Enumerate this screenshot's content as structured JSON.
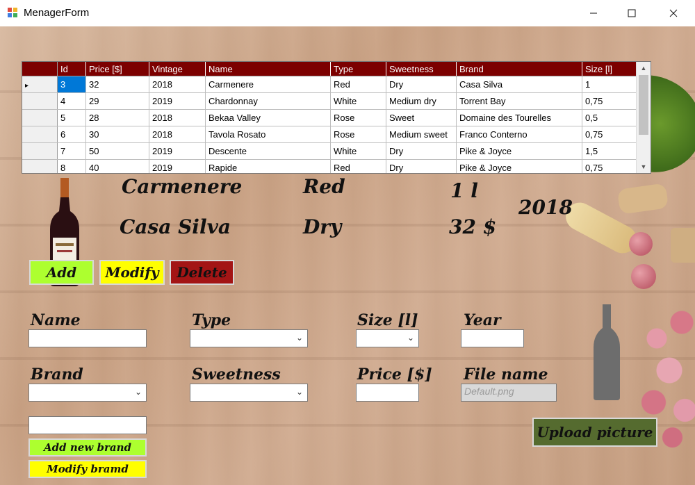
{
  "window": {
    "title": "MenagerForm"
  },
  "grid": {
    "columns": [
      "Id",
      "Price [$]",
      "Vintage",
      "Name",
      "Type",
      "Sweetness",
      "Brand",
      "Size [l]"
    ],
    "rows": [
      [
        "3",
        "32",
        "2018",
        "Carmenere",
        "Red",
        "Dry",
        "Casa Silva",
        "1"
      ],
      [
        "4",
        "29",
        "2019",
        "Chardonnay",
        "White",
        "Medium dry",
        "Torrent Bay",
        "0,75"
      ],
      [
        "5",
        "28",
        "2018",
        "Bekaa Valley",
        "Rose",
        "Sweet",
        "Domaine des Tourelles",
        "0,5"
      ],
      [
        "6",
        "30",
        "2018",
        "Tavola Rosato",
        "Rose",
        "Medium sweet",
        "Franco Conterno",
        "0,75"
      ],
      [
        "7",
        "50",
        "2019",
        "Descente",
        "White",
        "Dry",
        "Pike & Joyce",
        "1,5"
      ],
      [
        "8",
        "40",
        "2019",
        "Rapide",
        "Red",
        "Dry",
        "Pike & Joyce",
        "0,75"
      ]
    ],
    "selected_row_indicator": "▸"
  },
  "detail": {
    "name": "Carmenere",
    "brand": "Casa Silva",
    "type": "Red",
    "sweetness": "Dry",
    "size": "1 l",
    "price": "32 $",
    "vintage": "2018"
  },
  "buttons": {
    "add": "Add",
    "modify": "Modify",
    "delete": "Delete",
    "add_brand": "Add new brand",
    "modify_brand": "Modify bramd",
    "upload": "Upload picture"
  },
  "form": {
    "name_label": "Name",
    "type_label": "Type",
    "size_label": "Size [l]",
    "year_label": "Year",
    "brand_label": "Brand",
    "sweetness_label": "Sweetness",
    "price_label": "Price [$]",
    "filename_label": "File name",
    "filename_value": "Default.png"
  },
  "colors": {
    "header": "#7c0000",
    "add_btn": "#adff2f",
    "modify_btn": "#ffff00",
    "delete_btn": "#a31515",
    "upload_btn": "#556b2f"
  }
}
